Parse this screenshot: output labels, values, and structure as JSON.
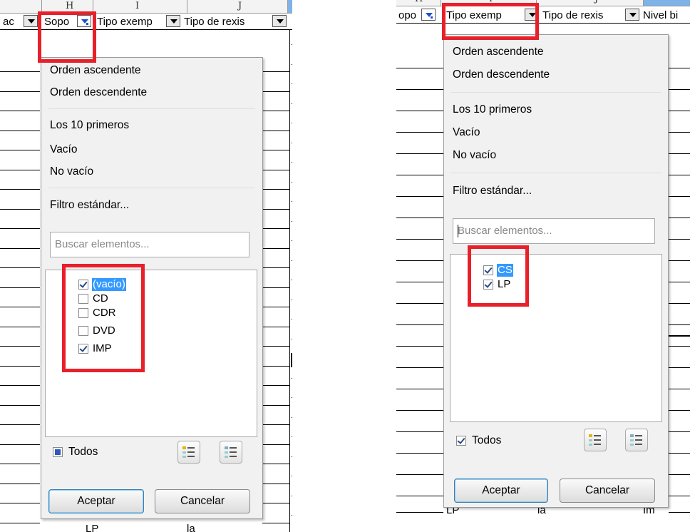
{
  "left": {
    "columns": [
      "H",
      "I",
      "J"
    ],
    "headers": [
      "ac",
      "Sopo",
      "Tipo exemp",
      "Tipo de rexis"
    ],
    "popup": {
      "sort_asc": "Orden ascendente",
      "sort_desc": "Orden descendente",
      "top10": "Los 10 primeros",
      "empty": "Vacío",
      "not_empty": "No vacío",
      "standard_filter": "Filtro estándar...",
      "search_placeholder": "Buscar elementos...",
      "items": [
        {
          "label": "(vacío)",
          "checked": true,
          "selected": true
        },
        {
          "label": "CD",
          "checked": false,
          "selected": false
        },
        {
          "label": "CDR",
          "checked": false,
          "selected": false
        },
        {
          "label": "DVD",
          "checked": false,
          "selected": false
        },
        {
          "label": "IMP",
          "checked": true,
          "selected": false
        }
      ],
      "all_label": "Todos",
      "all_state": "partial",
      "ok": "Aceptar",
      "cancel": "Cancelar"
    },
    "bottom_cells": [
      "LP",
      "la"
    ]
  },
  "right": {
    "columns": [
      "H",
      "I",
      "J"
    ],
    "headers": [
      "opo",
      "Tipo exemp",
      "Tipo de rexis",
      "Nivel bi"
    ],
    "popup": {
      "sort_asc": "Orden ascendente",
      "sort_desc": "Orden descendente",
      "top10": "Los 10 primeros",
      "empty": "Vacío",
      "not_empty": "No vacío",
      "standard_filter": "Filtro estándar...",
      "search_placeholder": "Buscar elementos...",
      "items": [
        {
          "label": "CS",
          "checked": true,
          "selected": true
        },
        {
          "label": "LP",
          "checked": true,
          "selected": false
        }
      ],
      "all_label": "Todos",
      "all_state": "checked",
      "ok": "Aceptar",
      "cancel": "Cancelar"
    },
    "bottom_cells": [
      "LP",
      "la",
      "Im"
    ]
  },
  "colors": {
    "highlight": "#e8202a",
    "selection": "#3399ff",
    "column_selected": "#7fb2e6"
  }
}
